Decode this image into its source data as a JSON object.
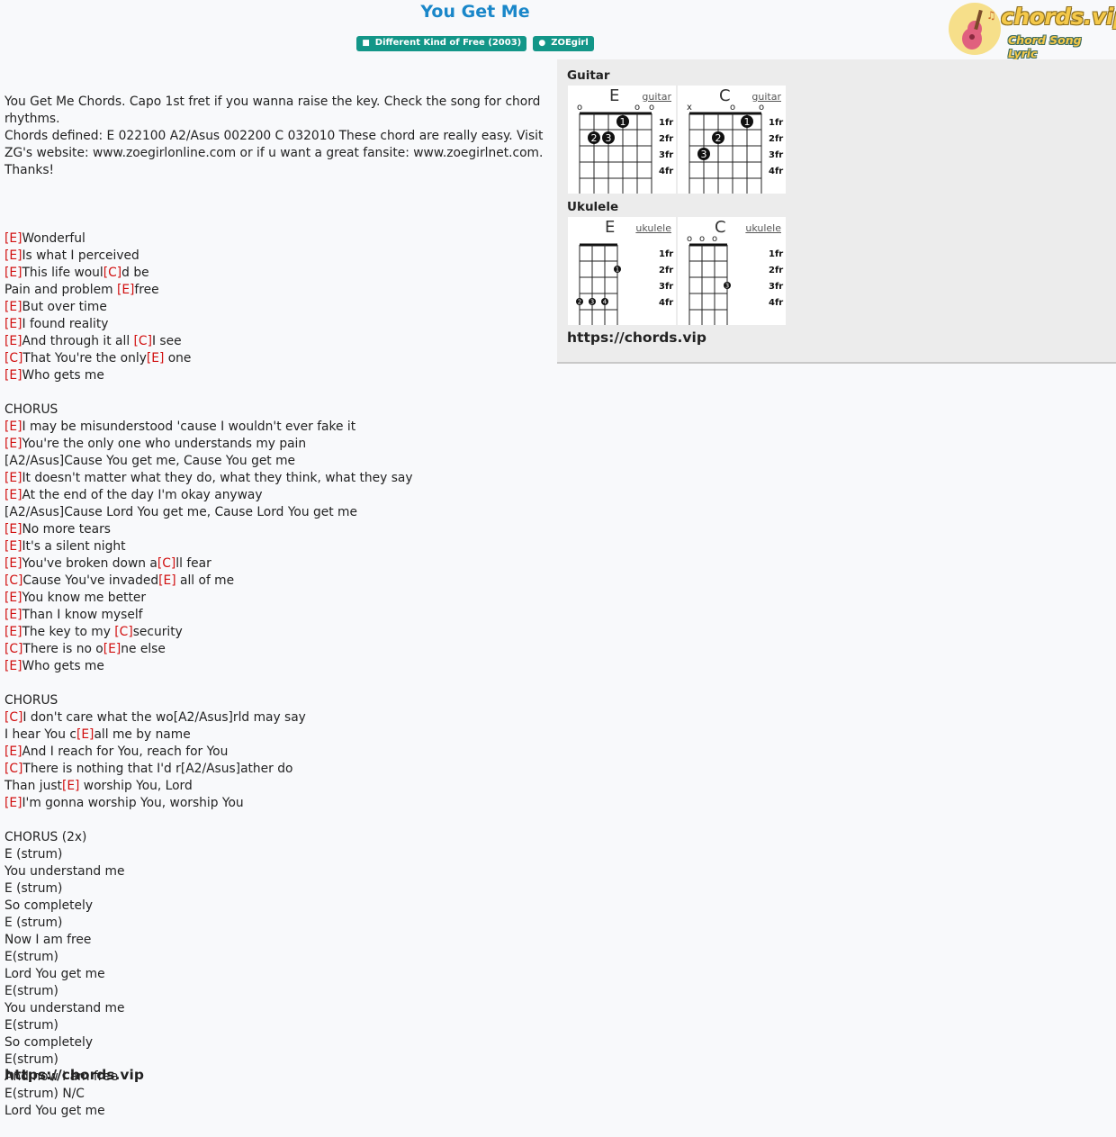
{
  "song": {
    "title": "You Get Me",
    "album": "Different Kind of Free (2003)",
    "artist": "ZOEgirl"
  },
  "logo": {
    "name": "chords.vip",
    "tagline": "Chord Song Lyric"
  },
  "intro": [
    "You Get Me Chords. Capo 1st fret if you wanna raise the key. Check the song for chord",
    "rhythms.",
    "Chords defined: E 022100 A2/Asus 002200 C 032010 These chord are really easy. Visit",
    "ZG's website: www.zoegirlonline.com or if u want a great fansite: www.zoegirlnet.com.",
    "Thanks!"
  ],
  "lyrics": [
    "",
    "[E]Wonderful",
    "[E]Is what I perceived",
    "[E]This life woul[C]d be",
    "Pain and problem [E]free",
    "[E]But over time",
    "[E]I found reality",
    "[E]And through it all [C]I see",
    "[C]That You're the only[E] one",
    "[E]Who gets me",
    "",
    "CHORUS",
    "[E]I may be misunderstood 'cause I wouldn't ever fake it",
    "[E]You're the only one who understands my pain",
    "{A2/Asus}Cause You get me, Cause You get me",
    "[E]It doesn't matter what they do, what they think, what they say",
    "[E]At the end of the day I'm okay anyway",
    "{A2/Asus}Cause Lord You get me, Cause Lord You get me",
    "[E]No more tears",
    "[E]It's a silent night",
    "[E]You've broken down a[C]ll fear",
    "[C]Cause You've invaded[E] all of me",
    "[E]You know me better",
    "[E]Than I know myself",
    "[E]The key to my [C]security",
    "[C]There is no o[E]ne else",
    "[E]Who gets me",
    "",
    "CHORUS",
    "[C]I don't care what the wo{A2/Asus}rld may say",
    "I hear You c[E]all me by name",
    "[E]And I reach for You, reach for You",
    "[C]There is nothing that I'd r{A2/Asus}ather do",
    "Than just[E] worship You, Lord",
    "[E]I'm gonna worship You, worship You",
    "",
    "CHORUS (2x)",
    "E (strum)",
    "You understand me",
    "E (strum)",
    "So completely",
    "E (strum)",
    "Now I am free",
    "E(strum)",
    "Lord You get me",
    "E(strum)",
    "You understand me",
    "E(strum)",
    "So completely",
    "E(strum)",
    "And now I am free",
    "E(strum) N/C",
    "Lord You get me"
  ],
  "footer_link": "https://chords.vip",
  "panel": {
    "guitar_heading": "Guitar",
    "ukulele_heading": "Ukulele",
    "link": "https://chords.vip",
    "fret_labels": [
      "1fr",
      "2fr",
      "3fr",
      "4fr"
    ],
    "guitar_chords": [
      {
        "name": "E",
        "link": "guitar",
        "top": [
          "o",
          "",
          "",
          "",
          "o",
          "o"
        ],
        "dots": [
          {
            "string": 4,
            "fret": 1,
            "finger": "1"
          },
          {
            "string": 2,
            "fret": 2,
            "finger": "2"
          },
          {
            "string": 3,
            "fret": 2,
            "finger": "3"
          }
        ]
      },
      {
        "name": "C",
        "link": "guitar",
        "top": [
          "x",
          "",
          "",
          "o",
          "",
          "o"
        ],
        "dots": [
          {
            "string": 5,
            "fret": 1,
            "finger": "1"
          },
          {
            "string": 3,
            "fret": 2,
            "finger": "2"
          },
          {
            "string": 2,
            "fret": 3,
            "finger": "3"
          }
        ]
      }
    ],
    "ukulele_chords": [
      {
        "name": "E",
        "link": "ukulele",
        "top": [
          "",
          "",
          "",
          ""
        ],
        "dots": [
          {
            "string": 4,
            "fret": 2,
            "finger": "1"
          },
          {
            "string": 1,
            "fret": 4,
            "finger": "2"
          },
          {
            "string": 2,
            "fret": 4,
            "finger": "3"
          },
          {
            "string": 3,
            "fret": 4,
            "finger": "4"
          }
        ]
      },
      {
        "name": "C",
        "link": "ukulele",
        "top": [
          "o",
          "o",
          "o",
          ""
        ],
        "dots": [
          {
            "string": 4,
            "fret": 3,
            "finger": "3"
          }
        ]
      }
    ]
  }
}
